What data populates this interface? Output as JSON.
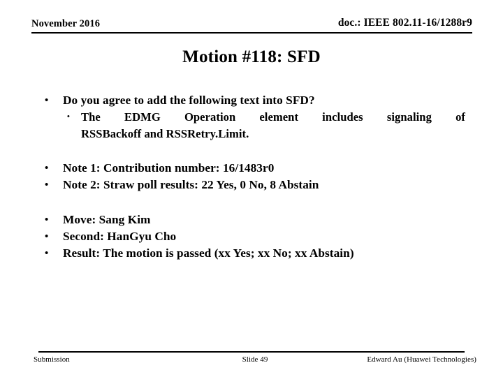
{
  "header": {
    "date": "November 2016",
    "doc": "doc.: IEEE 802.11-16/1288r9"
  },
  "title": "Motion #118:  SFD",
  "body": {
    "group1": {
      "bullet1": "Do you agree to add the following text into SFD?",
      "sub1_line1": "The EDMG Operation element includes signaling of",
      "sub1_line2": "RSSBackoff and RSSRetry.Limit."
    },
    "group2": {
      "note1": "Note 1:  Contribution number:  16/1483r0",
      "note2": "Note 2:  Straw poll results:  22 Yes, 0 No, 8 Abstain"
    },
    "group3": {
      "move": "Move:  Sang Kim",
      "second": "Second:  HanGyu Cho",
      "result": "Result:  The motion is passed (xx Yes; xx No; xx Abstain)"
    }
  },
  "bullets": {
    "level1_marker": "•",
    "level2_marker": "•"
  },
  "footer": {
    "left": "Submission",
    "center": "Slide 49",
    "right": "Edward Au (Huawei Technologies)"
  }
}
